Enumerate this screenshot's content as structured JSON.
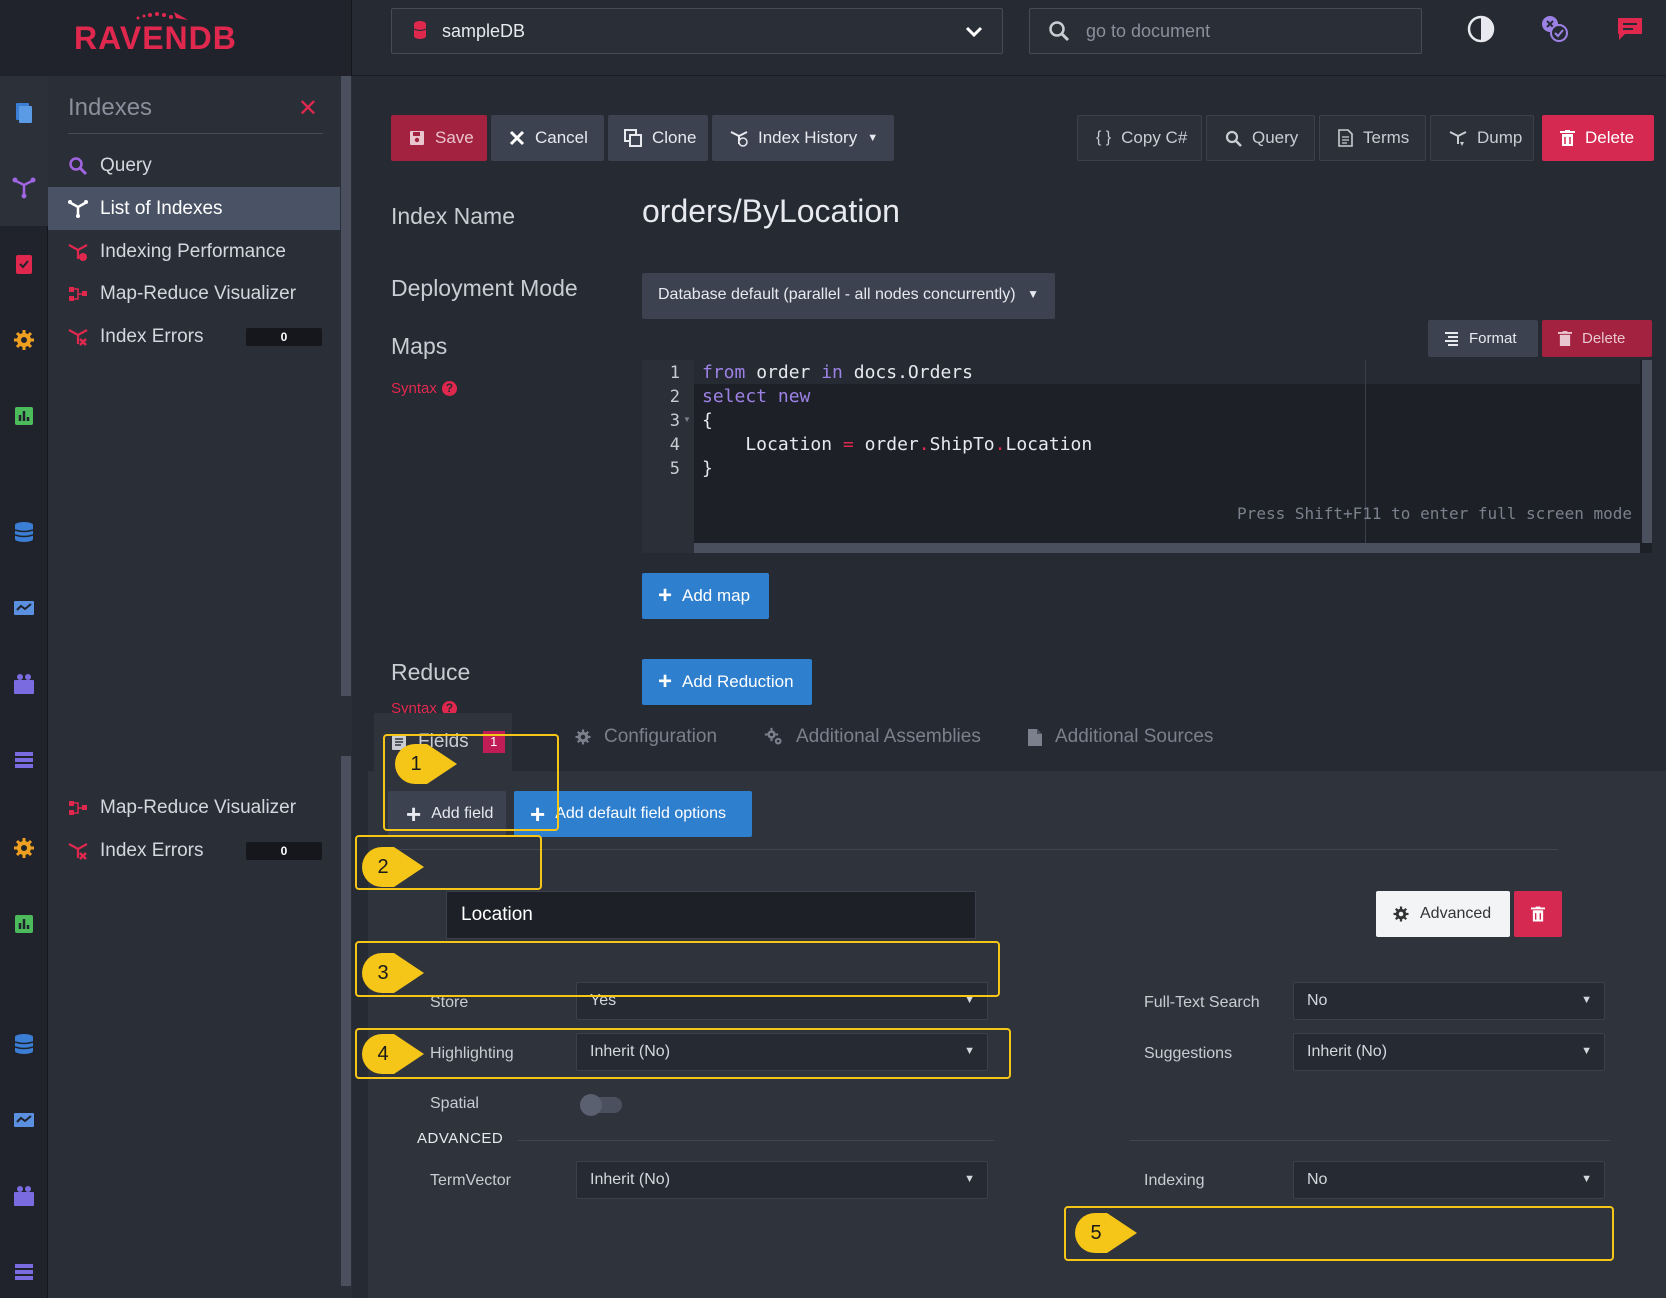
{
  "app": {
    "logo": "RAVENDB",
    "database": "sampleDB",
    "search_placeholder": "go to document"
  },
  "sidebar": {
    "title": "Indexes",
    "items": [
      {
        "label": "Query"
      },
      {
        "label": "List of Indexes"
      },
      {
        "label": "Indexing Performance"
      },
      {
        "label": "Map-Reduce Visualizer"
      },
      {
        "label": "Index Errors",
        "count": "0"
      }
    ],
    "items_repeat": [
      {
        "label": "Map-Reduce Visualizer"
      },
      {
        "label": "Index Errors",
        "count": "0"
      }
    ]
  },
  "toolbar": {
    "save": "Save",
    "cancel": "Cancel",
    "clone": "Clone",
    "index_history": "Index History",
    "copy_cs": "Copy C#",
    "query": "Query",
    "terms": "Terms",
    "dump": "Dump",
    "delete": "Delete"
  },
  "form": {
    "index_name_label": "Index Name",
    "index_name": "orders/ByLocation",
    "deployment_label": "Deployment Mode",
    "deployment_value": "Database default (parallel - all nodes concurrently)",
    "maps_label": "Maps",
    "syntax": "Syntax",
    "format": "Format",
    "map_delete": "Delete",
    "add_map": "Add map",
    "reduce_label": "Reduce",
    "add_reduction": "Add Reduction"
  },
  "editor": {
    "lines": [
      "1",
      "2",
      "3",
      "4",
      "5"
    ],
    "line1_kw1": "from",
    "line1_mid": " order ",
    "line1_kw2": "in",
    "line1_end": " docs.Orders",
    "line2_kw1": "select",
    "line2_kw2": "new",
    "line3": "{",
    "line4_a": "    Location ",
    "line4_eq": "=",
    "line4_b": " order",
    "line4_dot1": ".",
    "line4_c": "ShipTo",
    "line4_dot2": ".",
    "line4_d": "Location",
    "line5": "}",
    "hint": "Press Shift+F11 to enter full screen mode"
  },
  "tabs": {
    "fields": "Fields",
    "fields_count": "1",
    "configuration": "Configuration",
    "assemblies": "Additional Assemblies",
    "sources": "Additional Sources"
  },
  "fields": {
    "add_field": "Add field",
    "add_default": "Add default field options",
    "field_name": "Location",
    "advanced_btn": "Advanced",
    "store_label": "Store",
    "store_value": "Yes",
    "highlighting_label": "Highlighting",
    "highlighting_value": "Inherit (No)",
    "spatial_label": "Spatial",
    "advanced_head": "ADVANCED",
    "termvector_label": "TermVector",
    "termvector_value": "Inherit (No)",
    "fts_label": "Full-Text Search",
    "fts_value": "No",
    "suggestions_label": "Suggestions",
    "suggestions_value": "Inherit (No)",
    "indexing_label": "Indexing",
    "indexing_value": "No"
  },
  "callouts": [
    "1",
    "2",
    "3",
    "4",
    "5"
  ],
  "colors": {
    "accent_red": "#d52951",
    "accent_blue": "#2f7fcf",
    "callout_yellow": "#f5c518",
    "keyword_purple": "#9d82e6"
  }
}
